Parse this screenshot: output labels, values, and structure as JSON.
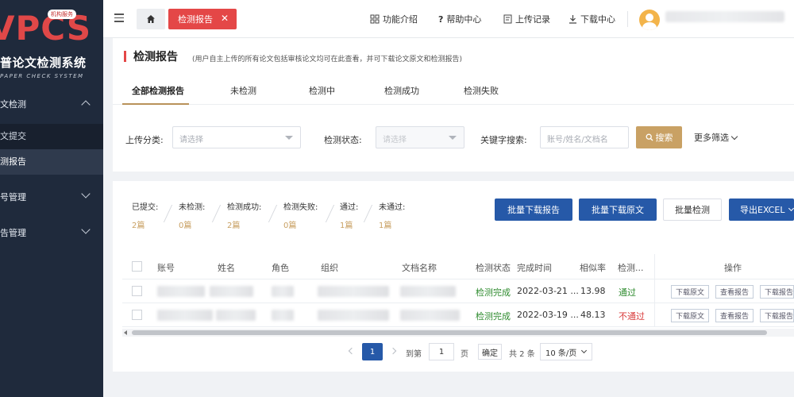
{
  "sidebar": {
    "logo_text": "VPCS",
    "logo_badge": "机构服务",
    "logo_cn": "普论文检测系统",
    "logo_en": "PAPER CHECK SYSTEM",
    "groups": [
      {
        "label": "文检测",
        "expanded": true,
        "items": [
          {
            "label": "文提交",
            "active": false
          },
          {
            "label": "测报告",
            "active": true
          }
        ]
      },
      {
        "label": "号管理",
        "expanded": false
      },
      {
        "label": "告管理",
        "expanded": false
      }
    ]
  },
  "topbar": {
    "home_icon": "home-icon",
    "active_tab": "检测报告",
    "links": [
      "功能介绍",
      "帮助中心",
      "上传记录",
      "下载中心"
    ]
  },
  "header": {
    "title": "检测报告",
    "subtitle": "(用户自主上传的所有论文包括审核论文均可在此查看，并可下载论文原文和检测报告)"
  },
  "tabs": [
    "全部检测报告",
    "未检测",
    "检测中",
    "检测成功",
    "检测失败"
  ],
  "filters": {
    "category_label": "上传分类:",
    "category_placeholder": "请选择",
    "status_label": "检测状态:",
    "status_placeholder": "请选择",
    "keyword_label": "关键字搜索:",
    "keyword_placeholder": "账号/姓名/文档名",
    "search_button": "搜索",
    "more_filter": "更多筛选"
  },
  "stats": [
    {
      "label": "已提交:",
      "value": "2篇"
    },
    {
      "label": "未检测:",
      "value": "0篇"
    },
    {
      "label": "检测成功:",
      "value": "2篇"
    },
    {
      "label": "检测失败:",
      "value": "0篇"
    },
    {
      "label": "通过:",
      "value": "1篇"
    },
    {
      "label": "未通过:",
      "value": "1篇"
    }
  ],
  "actions": {
    "batch_download_report": "批量下载报告",
    "batch_download_original": "批量下载原文",
    "batch_check": "批量检测",
    "export_excel": "导出EXCEL"
  },
  "table": {
    "headers": [
      "账号",
      "姓名",
      "角色",
      "组织",
      "文档名称",
      "检测状态",
      "完成时间",
      "相似率",
      "检测...",
      "操作"
    ],
    "rows": [
      {
        "status": "检测完成",
        "time": "2022-03-21 ...",
        "similarity": "13.98",
        "result": "通过",
        "result_ok": true
      },
      {
        "status": "检测完成",
        "time": "2022-03-19 ...",
        "similarity": "48.13",
        "result": "不通过",
        "result_ok": false
      }
    ],
    "row_actions": [
      "下载原文",
      "查看报告",
      "下载报告"
    ]
  },
  "pagination": {
    "current_page": "1",
    "goto_label": "到第",
    "goto_value": "1",
    "page_unit": "页",
    "confirm": "确定",
    "total": "共 2 条",
    "page_size": "10 条/页"
  }
}
